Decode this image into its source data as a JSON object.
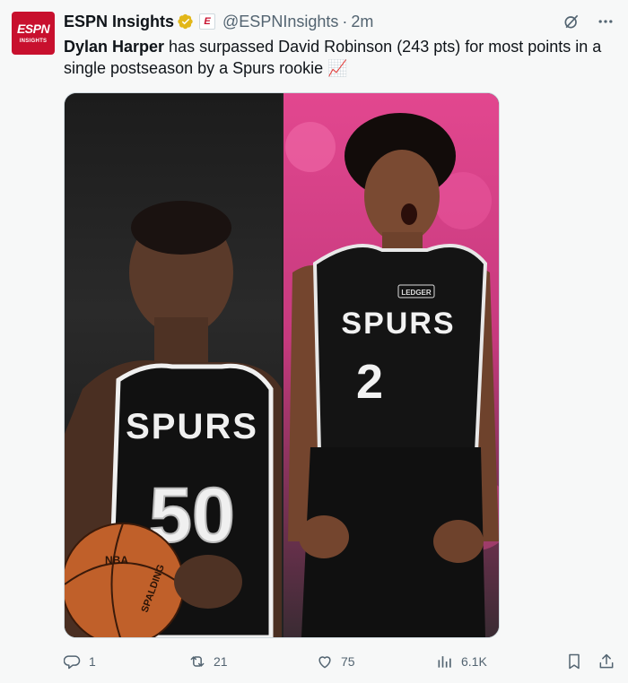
{
  "author": {
    "name": "ESPN Insights",
    "handle": "@ESPNInsights",
    "separator": "·",
    "time": "2m",
    "avatar_brand": "ESPN",
    "avatar_sub": "INSIGHTS",
    "affiliate_badge": "E"
  },
  "tweet": {
    "lead": "Dylan Harper",
    "rest": " has surpassed David Robinson (243 pts) for most points in a single postseason by a Spurs rookie",
    "emoji": "📈"
  },
  "media": {
    "left_alt": "David Robinson in Spurs jersey #50 holding a basketball",
    "right_alt": "Dylan Harper in Spurs jersey #2 celebrating",
    "left_jersey_text": "SPURS",
    "left_number": "50",
    "right_jersey_text": "SPURS",
    "right_number": "2",
    "right_patch": "LEDGER",
    "ball_text": "NBA",
    "ball_brand": "SPALDING"
  },
  "actions": {
    "replies": "1",
    "reposts": "21",
    "likes": "75",
    "views": "6.1K"
  },
  "colors": {
    "text": "#0f1419",
    "muted": "#536471",
    "espn_red": "#c8102e",
    "verified_gold": "#e2b719"
  },
  "icons": [
    "verified-badge-icon",
    "grok-icon",
    "more-icon",
    "reply-icon",
    "repost-icon",
    "like-icon",
    "views-icon",
    "bookmark-icon",
    "share-icon"
  ]
}
